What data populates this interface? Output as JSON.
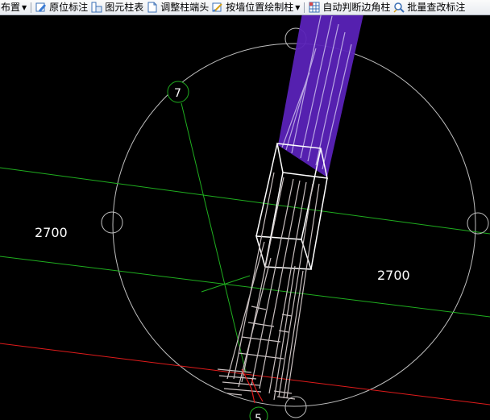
{
  "toolbar": {
    "items": [
      {
        "label": "布置",
        "icon": "dropdown-arrow-icon"
      },
      {
        "label": "原位标注",
        "icon": "annotate-pencil-icon"
      },
      {
        "label": "图元柱表",
        "icon": "column-table-icon"
      },
      {
        "label": "调整柱端头",
        "icon": "column-end-icon"
      },
      {
        "label": "按墙位置绘制柱",
        "icon": "wall-column-icon"
      },
      {
        "label": "自动判断边角柱",
        "icon": "grid-column-icon"
      },
      {
        "label": "批量查改标注",
        "icon": "batch-search-icon"
      }
    ]
  },
  "canvas": {
    "background": "#000000",
    "dimensions": [
      "2700",
      "2700"
    ],
    "axis_labels": [
      "7",
      "5"
    ],
    "colors": {
      "grid_green": "#1fae1f",
      "grid_red": "#e01b1b",
      "column_fill": "#5a22b8",
      "outline": "#ffffff",
      "rebar": "#c9c0c0"
    }
  }
}
